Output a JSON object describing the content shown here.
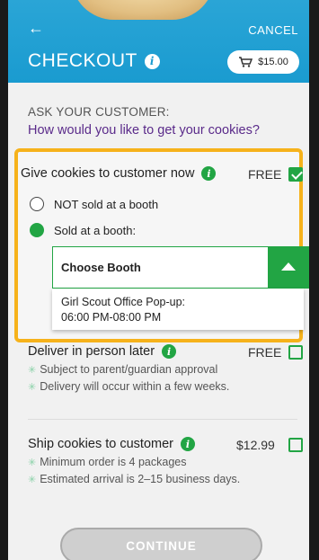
{
  "header": {
    "cancel_label": "CANCEL",
    "title": "CHECKOUT",
    "cart_total": "$15.00"
  },
  "ask": {
    "label": "ASK YOUR CUSTOMER:",
    "question": "How would you like to get your cookies?"
  },
  "give_now": {
    "title": "Give cookies to customer now",
    "price": "FREE",
    "checked": true,
    "radio_not_booth": "NOT sold at a booth",
    "radio_booth": "Sold at a booth:",
    "selected_radio": "booth",
    "dropdown_label": "Choose Booth",
    "dropdown_option": "Girl Scout Office Pop-up:\n06:00 PM-08:00 PM"
  },
  "deliver_later": {
    "title": "Deliver in person later",
    "price": "FREE",
    "checked": false,
    "notes": [
      "Subject to parent/guardian approval",
      "Delivery will occur within a few weeks."
    ]
  },
  "ship": {
    "title": "Ship cookies to customer",
    "price": "$12.99",
    "checked": false,
    "notes": [
      "Minimum order is 4 packages",
      "Estimated arrival is 2–15 business days."
    ]
  },
  "continue_label": "CONTINUE",
  "colors": {
    "header_blue": "#1a9bd0",
    "accent_green": "#22a544",
    "highlight_orange": "#f6b21b",
    "question_purple": "#5a2a8a"
  }
}
